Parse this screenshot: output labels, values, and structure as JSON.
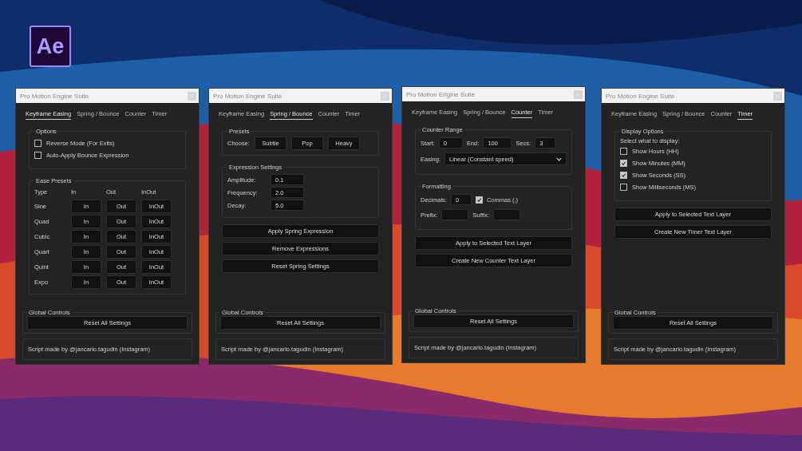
{
  "logo": {
    "text": "Ae"
  },
  "windows": [
    {
      "title": "Pro Motion Engine Suite",
      "tabs": [
        {
          "label": "Keyframe Easing",
          "selected": true
        },
        {
          "label": "Spring / Bounce",
          "selected": false
        },
        {
          "label": "Counter",
          "selected": false
        },
        {
          "label": "Timer",
          "selected": false
        }
      ],
      "sections": [
        {
          "kind": "checks",
          "title": "Options",
          "checkboxes": [
            {
              "label": "Reverse Mode (For Exits)",
              "checked": false
            },
            {
              "label": "Auto-Apply Bounce Expression",
              "checked": false
            }
          ]
        },
        {
          "kind": "ease_grid",
          "title": "Ease Presets",
          "headers": [
            "Type",
            "In",
            "Out",
            "InOut"
          ],
          "rows": [
            {
              "type": "Sine",
              "buttons": [
                "In",
                "Out",
                "InOut"
              ]
            },
            {
              "type": "Quad",
              "buttons": [
                "In",
                "Out",
                "InOut"
              ]
            },
            {
              "type": "Cubic",
              "buttons": [
                "In",
                "Out",
                "InOut"
              ]
            },
            {
              "type": "Quart",
              "buttons": [
                "In",
                "Out",
                "InOut"
              ]
            },
            {
              "type": "Quint",
              "buttons": [
                "In",
                "Out",
                "InOut"
              ]
            },
            {
              "type": "Expo",
              "buttons": [
                "In",
                "Out",
                "InOut"
              ]
            }
          ]
        }
      ],
      "global": {
        "title": "Global Controls",
        "button": "Reset All Settings"
      },
      "credit": "Script made by @jancarlo.tagudin (Instagram)"
    },
    {
      "title": "Pro Motion Engine Suite",
      "tabs": [
        {
          "label": "Keyframe Easing",
          "selected": false
        },
        {
          "label": "Spring / Bounce",
          "selected": true
        },
        {
          "label": "Counter",
          "selected": false
        },
        {
          "label": "Timer",
          "selected": false
        }
      ],
      "sections": [
        {
          "kind": "preset_buttons",
          "title": "Presets",
          "label": "Choose:",
          "buttons": [
            "Subtle",
            "Pop",
            "Heavy"
          ]
        },
        {
          "kind": "fields",
          "title": "Expression Settings",
          "fields": [
            {
              "label": "Amplitude:",
              "value": "0.1"
            },
            {
              "label": "Frequency:",
              "value": "2.0"
            },
            {
              "label": "Decay:",
              "value": "5.0"
            }
          ]
        },
        {
          "kind": "actions",
          "buttons": [
            "Apply Spring Expression",
            "Remove Expressions",
            "Reset Spring Settings"
          ]
        }
      ],
      "global": {
        "title": "Global Controls",
        "button": "Reset All Settings"
      },
      "credit": "Script made by @jancarlo.tagudin (Instagram)"
    },
    {
      "title": "Pro Motion Engine Suite",
      "tabs": [
        {
          "label": "Keyframe Easing",
          "selected": false
        },
        {
          "label": "Spring / Bounce",
          "selected": false
        },
        {
          "label": "Counter",
          "selected": true
        },
        {
          "label": "Timer",
          "selected": false
        }
      ],
      "sections": [
        {
          "kind": "counter_range",
          "title": "Counter Range",
          "fields": [
            {
              "label": "Start:",
              "value": "0"
            },
            {
              "label": "End:",
              "value": "100"
            },
            {
              "label": "Secs:",
              "value": "3"
            }
          ],
          "easing": {
            "label": "Easing:",
            "value": "Linear (Constant speed)"
          }
        },
        {
          "kind": "formatting",
          "title": "Formatting",
          "decimals": {
            "label": "Decimals:",
            "value": "0"
          },
          "commas": {
            "label": "Commas (,)",
            "checked": true
          },
          "affixes": [
            {
              "label": "Prefix:"
            },
            {
              "label": "Suffix:"
            }
          ]
        },
        {
          "kind": "actions",
          "buttons": [
            "Apply to Selected Text Layer",
            "Create New Counter Text Layer"
          ]
        }
      ],
      "global": {
        "title": "Global Controls",
        "button": "Reset All Settings"
      },
      "credit": "Script made by @jancarlo.tagudin (Instagram)"
    },
    {
      "title": "Pro Motion Engine Suite",
      "tabs": [
        {
          "label": "Keyframe Easing",
          "selected": false
        },
        {
          "label": "Spring / Bounce",
          "selected": false
        },
        {
          "label": "Counter",
          "selected": false
        },
        {
          "label": "Timer",
          "selected": true
        }
      ],
      "sections": [
        {
          "kind": "checks",
          "title": "Display Options",
          "hint": "Select what to display:",
          "checkboxes": [
            {
              "label": "Show Hours (HH)",
              "checked": false
            },
            {
              "label": "Show Minutes (MM)",
              "checked": true
            },
            {
              "label": "Show Seconds (SS)",
              "checked": true
            },
            {
              "label": "Show Milliseconds (MS)",
              "checked": false
            }
          ]
        },
        {
          "kind": "actions",
          "buttons": [
            "Apply to Selected Text Layer",
            "Create New Timer Text Layer"
          ]
        }
      ],
      "global": {
        "title": "Global Controls",
        "button": "Reset All Settings"
      },
      "credit": "Script made by @jancarlo.tagudin (Instagram)"
    }
  ]
}
